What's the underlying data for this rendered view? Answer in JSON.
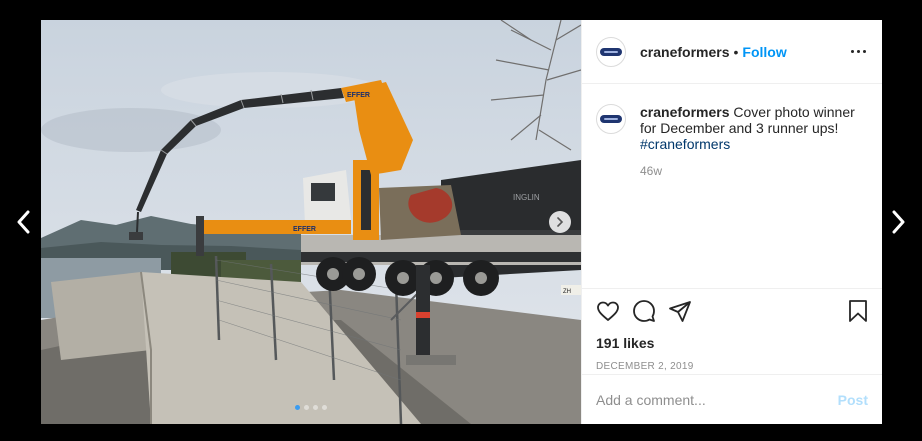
{
  "post": {
    "username": "craneformers",
    "separator": "•",
    "follow_label": "Follow",
    "more_icon": "more-options-icon"
  },
  "caption": {
    "username": "craneformers",
    "text": " Cover photo winner for December and 3 runner ups!",
    "hashtag": "#craneformers",
    "time_ago": "46w"
  },
  "stats": {
    "likes": "191 likes",
    "date": "DECEMBER 2, 2019"
  },
  "comment_box": {
    "placeholder": "Add a comment...",
    "post_label": "Post"
  },
  "carousel": {
    "slide_count": 4,
    "active_index": 0
  },
  "photo_text": {
    "boom_brand_1": "EFFER",
    "boom_brand_2": "EFFER",
    "truck_body": "INGLIN",
    "plate": "ZH"
  },
  "colors": {
    "follow": "#0095f6",
    "post_disabled": "#b2dffc",
    "hashtag": "#00376b",
    "crane_orange": "#e98e12"
  }
}
